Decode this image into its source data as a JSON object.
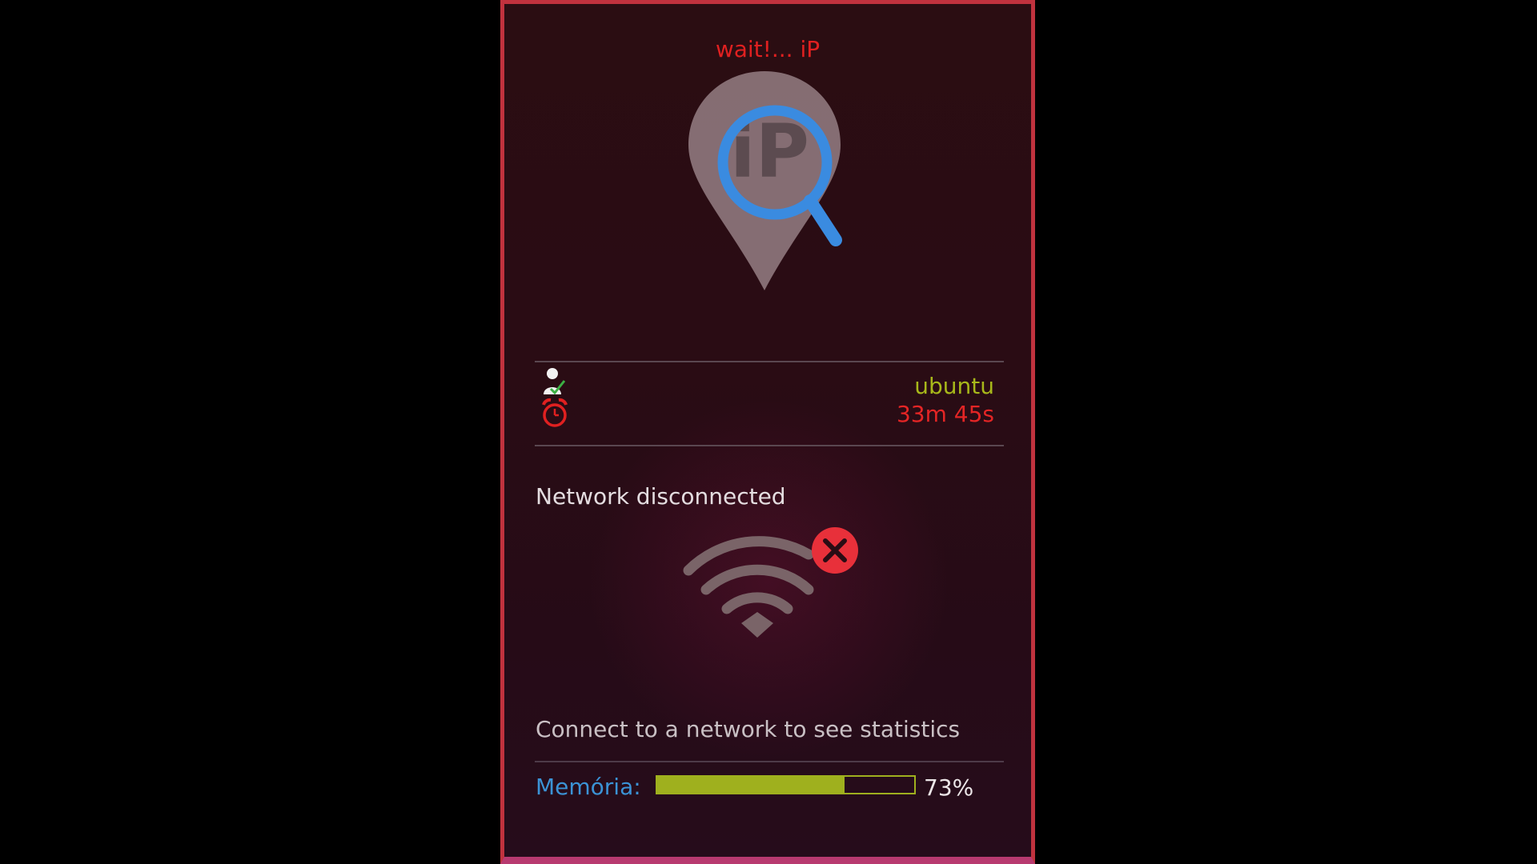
{
  "header": {
    "title": "wait!... iP"
  },
  "logo": {
    "icon": "ip-location-search-icon",
    "text": "iP",
    "pin_color": "#8a7378",
    "lens_color": "#3a8be0"
  },
  "session": {
    "user_icon": "user-check-icon",
    "alarm_icon": "alarm-clock-icon",
    "username": "ubuntu",
    "uptime": "33m 45s"
  },
  "network": {
    "status": "Network disconnected",
    "icon": "wifi-disconnected-icon",
    "hint": "Connect to a network to see statistics"
  },
  "memory": {
    "label": "Memória:",
    "percent_text": "73%",
    "percent_value": 73,
    "bar_color": "#9fb01e"
  },
  "colors": {
    "title": "#e02020",
    "username": "#a8b81a",
    "uptime": "#e42525",
    "memory_label": "#3b93d6",
    "border": "#c0323e"
  }
}
